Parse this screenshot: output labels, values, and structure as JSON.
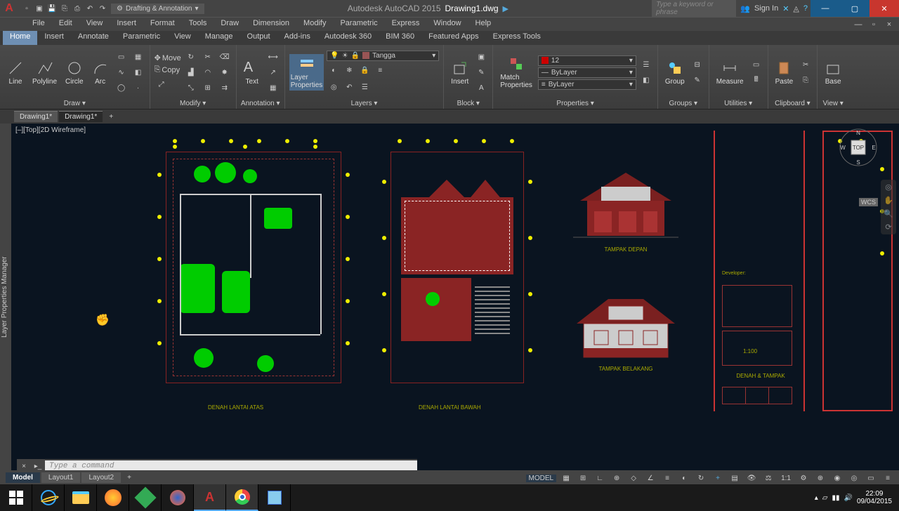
{
  "title": {
    "app": "Autodesk AutoCAD 2015",
    "doc": "Drawing1.dwg",
    "workspace": "Drafting & Annotation",
    "search_ph": "Type a keyword or phrase",
    "signin": "Sign In"
  },
  "menus": [
    "File",
    "Edit",
    "View",
    "Insert",
    "Format",
    "Tools",
    "Draw",
    "Dimension",
    "Modify",
    "Parametric",
    "Express",
    "Window",
    "Help"
  ],
  "tabs": [
    "Home",
    "Insert",
    "Annotate",
    "Parametric",
    "View",
    "Manage",
    "Output",
    "Add-ins",
    "Autodesk 360",
    "BIM 360",
    "Featured Apps",
    "Express Tools"
  ],
  "ribbon": {
    "draw": {
      "label": "Draw ▾",
      "line": "Line",
      "polyline": "Polyline",
      "circle": "Circle",
      "arc": "Arc"
    },
    "modify": {
      "label": "Modify ▾",
      "move": "Move",
      "copy": "Copy"
    },
    "annot": {
      "label": "Annotation ▾",
      "text": "Text"
    },
    "layers": {
      "label": "Layers ▾",
      "btn": "Layer\nProperties",
      "current": "Tangga"
    },
    "block": {
      "label": "Block ▾",
      "insert": "Insert"
    },
    "props": {
      "label": "Properties ▾",
      "match": "Match\nProperties",
      "color": "12",
      "lt": "ByLayer",
      "lw": "ByLayer"
    },
    "groups": {
      "label": "Groups ▾",
      "btn": "Group"
    },
    "util": {
      "label": "Utilities ▾",
      "btn": "Measure"
    },
    "clip": {
      "label": "Clipboard ▾",
      "btn": "Paste"
    },
    "view": {
      "label": "View ▾",
      "btn": "Base"
    }
  },
  "doctabs": [
    "Drawing1*",
    "Drawing1*"
  ],
  "side": "Layer Properties Manager",
  "vplabel": "[–][Top][2D Wireframe]",
  "viewcube": {
    "top": "TOP",
    "n": "N",
    "s": "S",
    "e": "E",
    "w": "W"
  },
  "wcs": "WCS",
  "drawings": {
    "plan1": "DENAH LANTAI ATAS",
    "plan2": "DENAH LANTAI BAWAH",
    "elev1": "TAMPAK DEPAN",
    "elev2": "TAMPAK BELAKANG",
    "sheet": "DENAH & TAMPAK",
    "scale": "1:100",
    "dev": "Developer:"
  },
  "cmd_ph": "Type a command",
  "modeltabs": [
    "Model",
    "Layout1",
    "Layout2"
  ],
  "status": {
    "model": "MODEL",
    "scale": "1:1"
  },
  "tray": {
    "time": "22:09",
    "date": "09/04/2015"
  }
}
